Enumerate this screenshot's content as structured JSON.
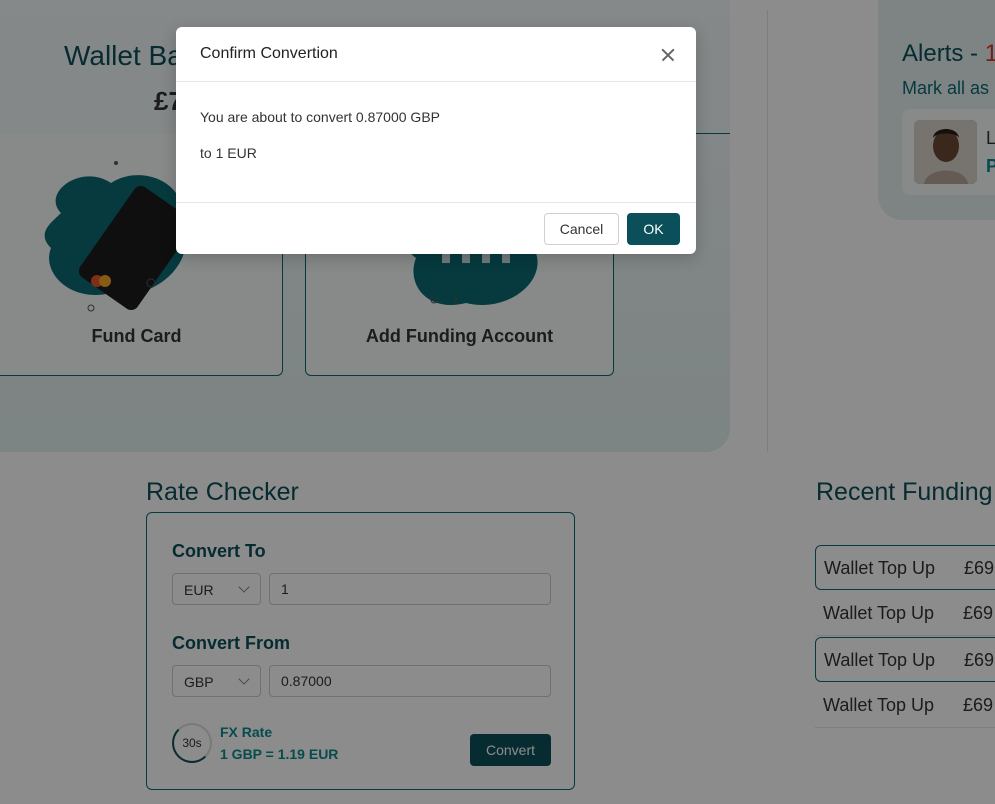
{
  "wallet": {
    "title": "Wallet Balance",
    "balance": "£7",
    "fund_card_label": "Fund Card",
    "add_funding_label": "Add Funding Account"
  },
  "alerts": {
    "title": "Alerts - ",
    "count": "1",
    "mark_all": "Mark all as read",
    "item_line1": "L",
    "item_line2": "P"
  },
  "rate_checker": {
    "title": "Rate Checker",
    "convert_to_label": "Convert To",
    "convert_to_currency": "EUR",
    "convert_to_amount": "1",
    "convert_from_label": "Convert From",
    "convert_from_currency": "GBP",
    "convert_from_amount": "0.87000",
    "timer": "30s",
    "fx_label": "FX Rate",
    "fx_value": "1 GBP = 1.19 EUR",
    "convert_button": "Convert"
  },
  "recent_funding": {
    "title": "Recent Funding",
    "rows": [
      {
        "name": "Wallet Top Up",
        "amount": "£69"
      },
      {
        "name": "Wallet Top Up",
        "amount": "£69"
      },
      {
        "name": "Wallet Top Up",
        "amount": "£69"
      },
      {
        "name": "Wallet Top Up",
        "amount": "£69"
      }
    ]
  },
  "modal": {
    "title": "Confirm Convertion",
    "line1": "You are about to convert 0.87000 GBP",
    "line2": "to 1 EUR",
    "cancel": "Cancel",
    "ok": "OK"
  },
  "colors": {
    "brand": "#0b4f5a",
    "accent": "#0b8a8f",
    "alert_count": "#d93a2b"
  }
}
